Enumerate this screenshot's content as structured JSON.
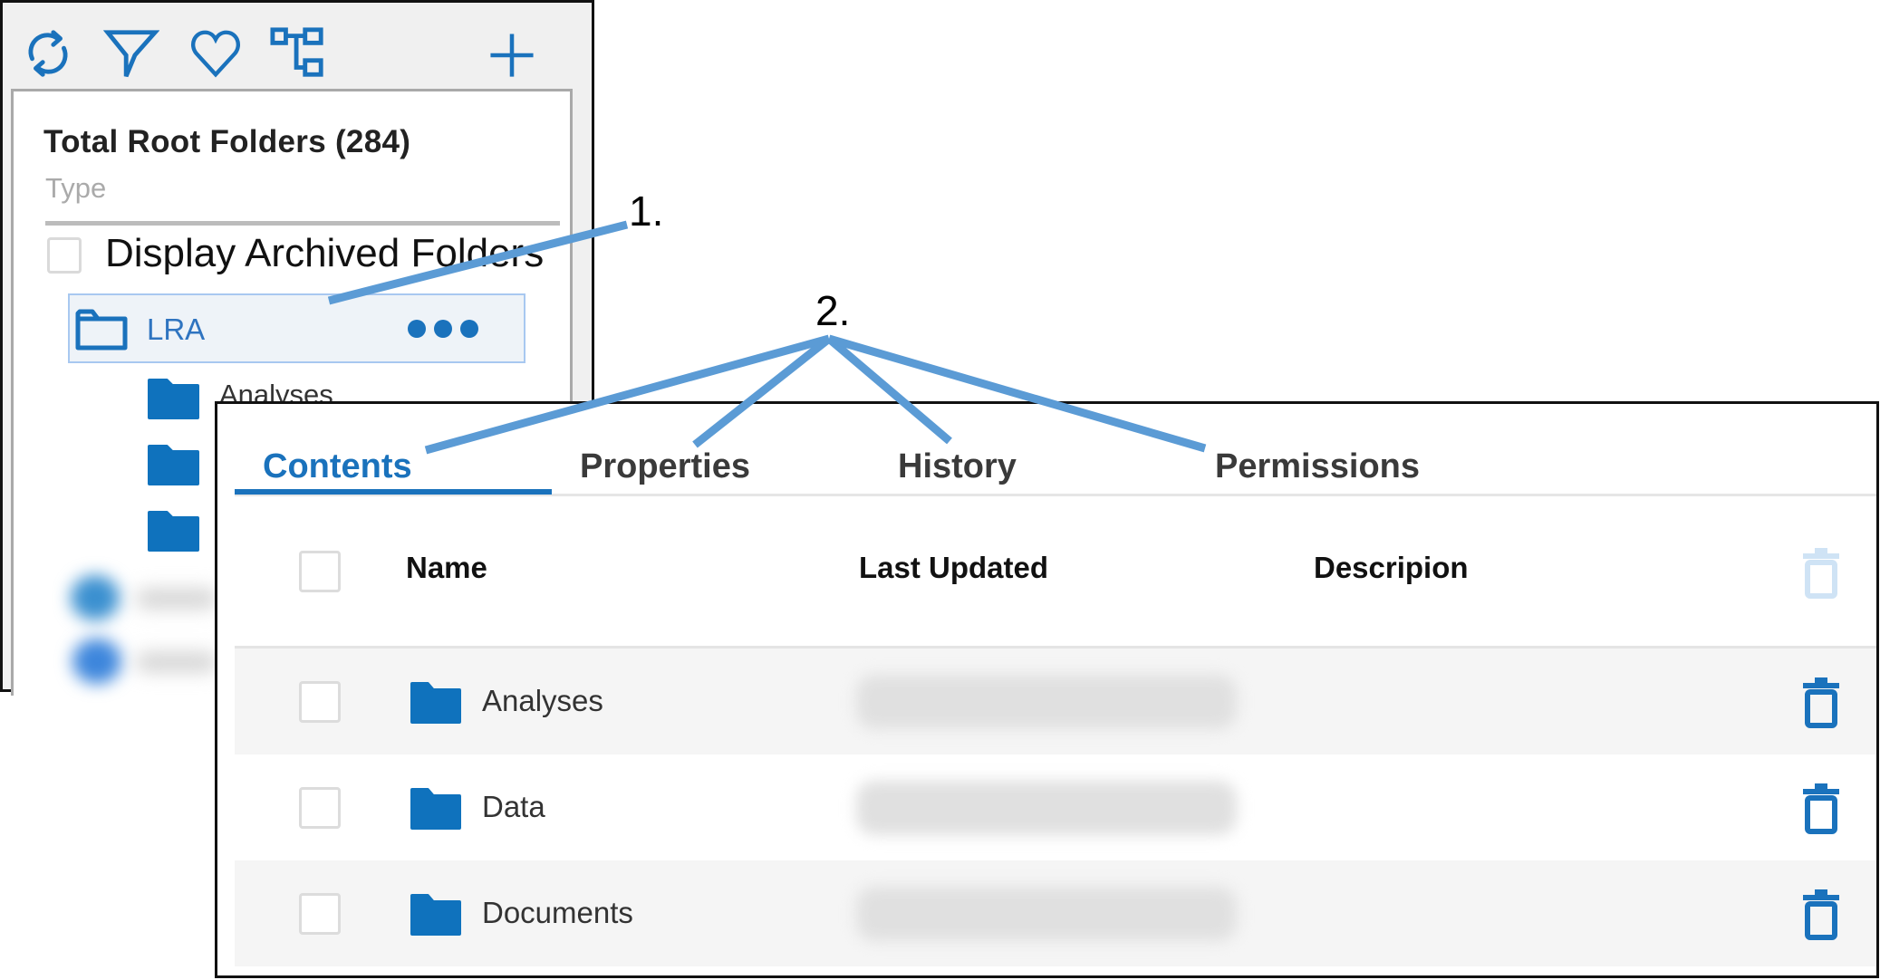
{
  "colors": {
    "accent": "#1a72bc",
    "annotation": "#5b9bd5",
    "disabled_icon": "#cfe3f5"
  },
  "tree_panel": {
    "toolbar": [
      {
        "icon": "refresh-icon",
        "label": "Refresh"
      },
      {
        "icon": "filter-icon",
        "label": "Filter"
      },
      {
        "icon": "heart-icon",
        "label": "Favorites"
      },
      {
        "icon": "hierarchy-icon",
        "label": "Hierarchy"
      },
      {
        "icon": "plus-icon",
        "label": "Add"
      }
    ],
    "total_label": "Total Root Folders (284)",
    "type_placeholder": "Type",
    "archived_checkbox": {
      "label": "Display Archived Folders",
      "checked": false
    },
    "selected_folder": {
      "name": "LRA",
      "icon": "folder-outline-icon",
      "more_icon": "more-horizontal-icon"
    },
    "subfolders": [
      {
        "name": "Analyses"
      },
      {
        "name": ""
      },
      {
        "name": ""
      }
    ],
    "blurred_items_count": 2
  },
  "content_panel": {
    "tabs": [
      {
        "label": "Contents",
        "active": true
      },
      {
        "label": "Properties",
        "active": false
      },
      {
        "label": "History",
        "active": false
      },
      {
        "label": "Permissions",
        "active": false
      }
    ],
    "columns": {
      "name": "Name",
      "last_updated": "Last Updated",
      "description": "Descripion"
    },
    "header_delete_enabled": false,
    "rows": [
      {
        "name": "Analyses",
        "last_updated": "[redacted]",
        "description": "",
        "checked": false
      },
      {
        "name": "Data",
        "last_updated": "[redacted]",
        "description": "",
        "checked": false
      },
      {
        "name": "Documents",
        "last_updated": "[redacted]",
        "description": "",
        "checked": false
      }
    ]
  },
  "annotations": [
    {
      "label": "1.",
      "target": "LRA folder row"
    },
    {
      "label": "2.",
      "target": "Contents / Properties / History / Permissions tabs"
    }
  ]
}
